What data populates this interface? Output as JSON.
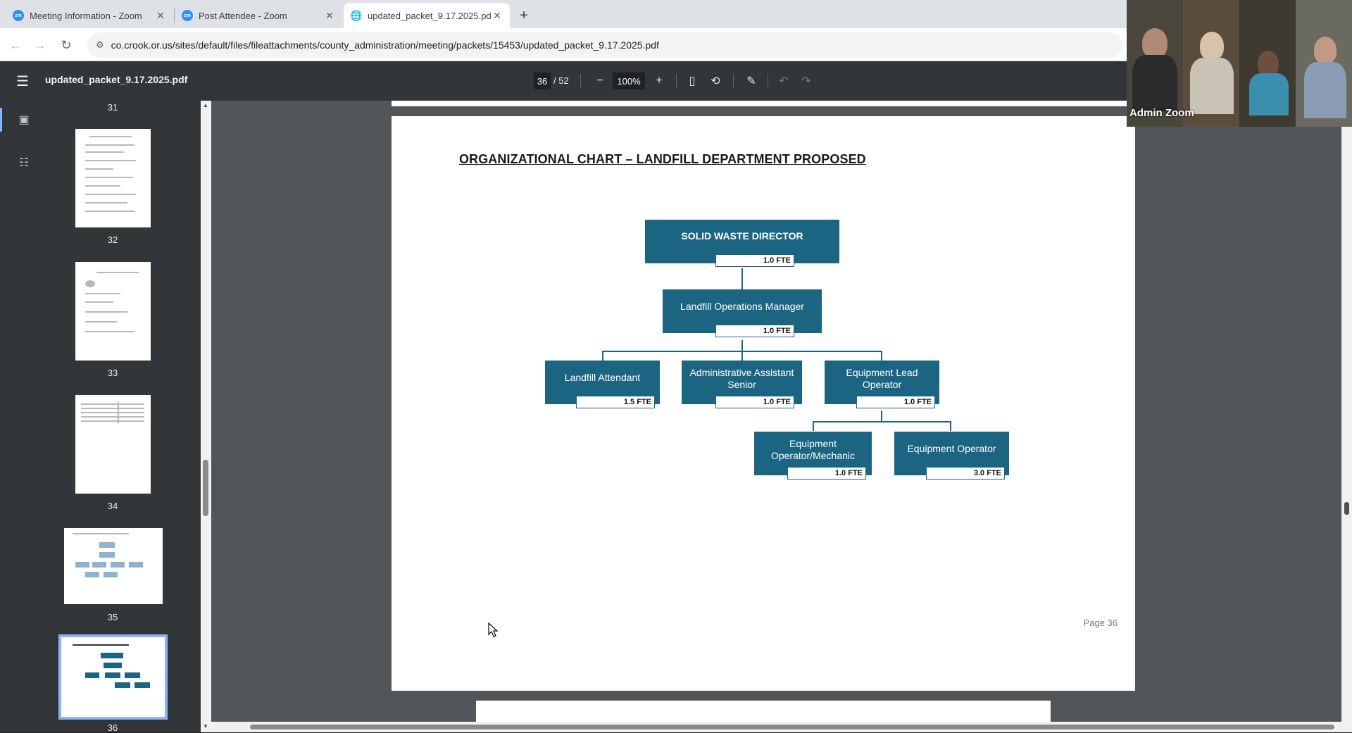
{
  "browser": {
    "tabs": [
      {
        "title": "Meeting Information - Zoom",
        "icon": "zoom-icon",
        "favicon_text": "zm"
      },
      {
        "title": "Post Attendee - Zoom",
        "icon": "zoom-icon",
        "favicon_text": "zm"
      },
      {
        "title": "updated_packet_9.17.2025.pdf",
        "icon": "globe-icon"
      }
    ],
    "url": "co.crook.or.us/sites/default/files/fileattachments/county_administration/meeting/packets/15453/updated_packet_9.17.2025.pdf"
  },
  "pdf_toolbar": {
    "filename": "updated_packet_9.17.2025.pdf",
    "current_page": "36",
    "total_pages": "/ 52",
    "zoom": "100%"
  },
  "sidebar": {
    "thumbnails": [
      {
        "page": "31"
      },
      {
        "page": "32"
      },
      {
        "page": "33"
      },
      {
        "page": "34"
      },
      {
        "page": "35"
      },
      {
        "page": "36",
        "selected": true
      }
    ]
  },
  "page": {
    "title": "ORGANIZATIONAL CHART – LANDFILL DEPARTMENT PROPOSED",
    "footer": "Page 36",
    "org": {
      "director": {
        "label": "SOLID WASTE DIRECTOR",
        "fte": "1.0 FTE"
      },
      "manager": {
        "label": "Landfill Operations Manager",
        "fte": "1.0 FTE"
      },
      "attendant": {
        "label": "Landfill Attendant",
        "fte": "1.5 FTE"
      },
      "admin": {
        "label": "Administrative Assistant Senior",
        "fte": "1.0 FTE"
      },
      "lead": {
        "label": "Equipment Lead Operator",
        "fte": "1.0 FTE"
      },
      "mechanic": {
        "label": "Equipment Operator/Mechanic",
        "fte": "1.0 FTE"
      },
      "operator": {
        "label": "Equipment Operator",
        "fte": "3.0 FTE"
      }
    }
  },
  "video": {
    "participant_label": "Admin Zoom"
  },
  "colors": {
    "org_box": "#1b6583",
    "pdf_toolbar": "#323639",
    "viewer_background": "#525659",
    "thumbnail_highlight": "#8ab4f8"
  }
}
